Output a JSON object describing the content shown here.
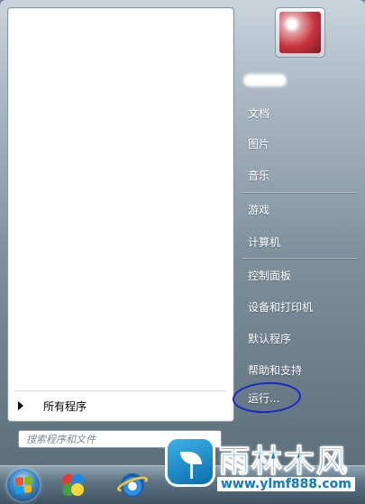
{
  "left_pane": {
    "all_programs_label": "所有程序",
    "search_placeholder": "搜索程序和文件"
  },
  "right_pane": {
    "items": [
      {
        "name": "documents",
        "label": "文档"
      },
      {
        "name": "pictures",
        "label": "图片"
      },
      {
        "name": "music",
        "label": "音乐"
      },
      {
        "name": "games",
        "label": "游戏"
      },
      {
        "name": "computer",
        "label": "计算机"
      },
      {
        "name": "control-panel",
        "label": "控制面板"
      },
      {
        "name": "devices-printers",
        "label": "设备和打印机"
      },
      {
        "name": "default-programs",
        "label": "默认程序"
      },
      {
        "name": "help-support",
        "label": "帮助和支持"
      },
      {
        "name": "run",
        "label": "运行..."
      }
    ]
  },
  "taskbar": {
    "icons": [
      "start-orb",
      "paint-icon",
      "internet-explorer-icon"
    ]
  },
  "watermark": {
    "title": "雨林木风",
    "url": "www.ylmf888.com"
  },
  "colors": {
    "annotation_circle": "#1a27c8",
    "watermark_blue": "#0f79c4"
  }
}
